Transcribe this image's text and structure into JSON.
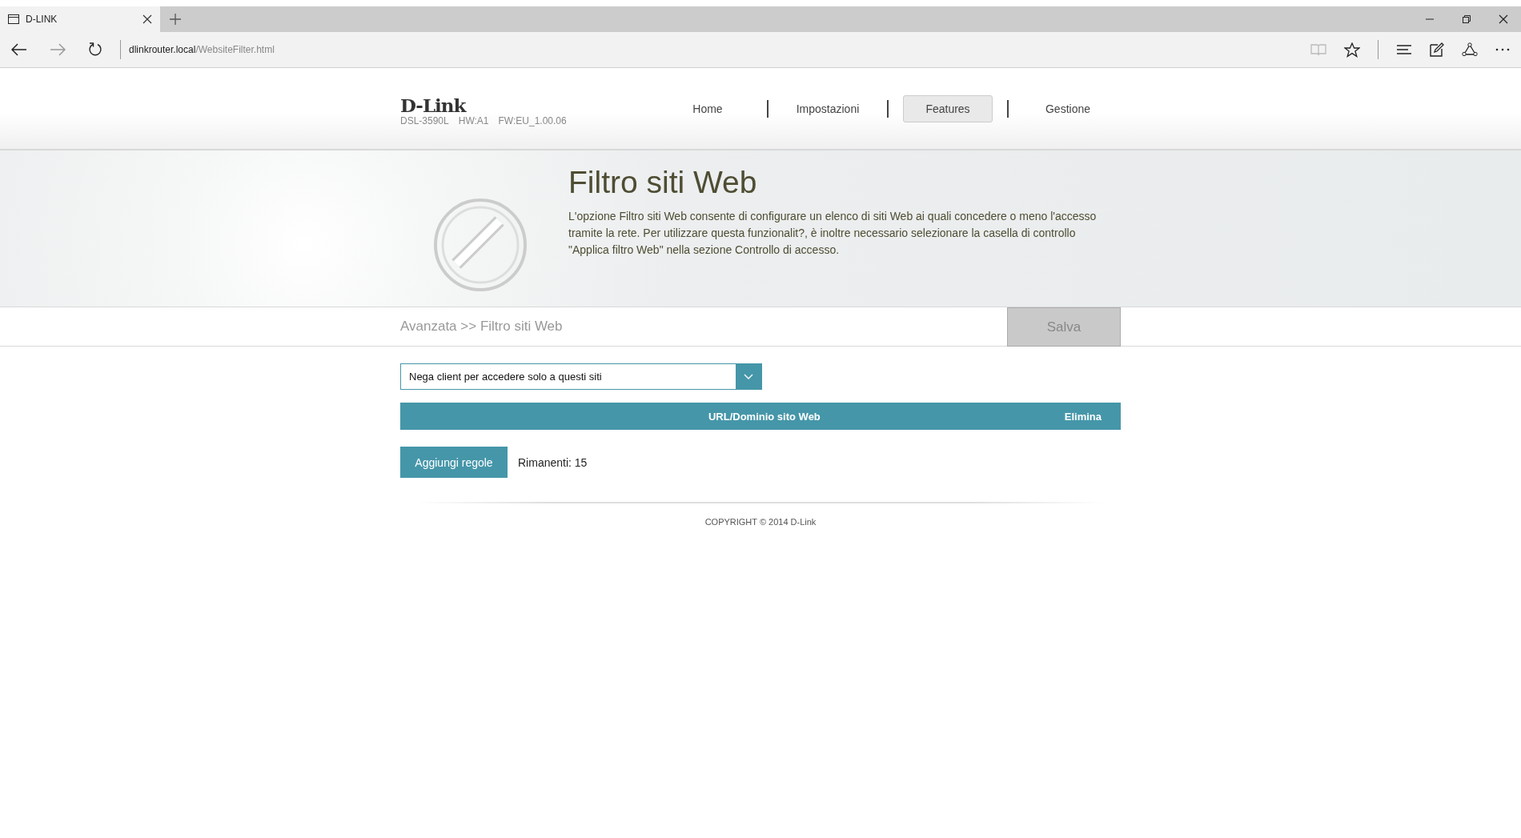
{
  "browser": {
    "tab": {
      "title": "D-LINK",
      "selected": true
    },
    "address": {
      "host": "dlinkrouter.local",
      "path": "/WebsiteFilter.html"
    }
  },
  "header": {
    "logo": "D-Link",
    "model": "DSL-3590L",
    "hw": "HW:A1",
    "fw": "FW:EU_1.00.06",
    "nav": [
      {
        "label": "Home",
        "selected": false
      },
      {
        "label": "Impostazioni",
        "selected": false
      },
      {
        "label": "Features",
        "selected": true
      },
      {
        "label": "Gestione",
        "selected": false
      }
    ]
  },
  "banner": {
    "title": "Filtro siti Web",
    "description": "L'opzione Filtro siti Web consente di configurare un elenco di siti Web ai quali concedere o meno l'accesso tramite la rete. Per utilizzare questa funzionalit?, è inoltre necessario selezionare la casella di controllo \"Applica filtro Web\" nella sezione Controllo di accesso."
  },
  "breadcrumb": "Avanzata >> Filtro siti Web",
  "save_button": "Salva",
  "filter_mode": {
    "value": "Nega client per accedere solo a questi siti"
  },
  "table": {
    "columns": [
      "URL/Dominio sito Web",
      "Elimina"
    ]
  },
  "add_button": "Aggiungi regole",
  "remaining": "Rimanenti: 15",
  "footer": "COPYRIGHT © 2014 D-Link"
}
